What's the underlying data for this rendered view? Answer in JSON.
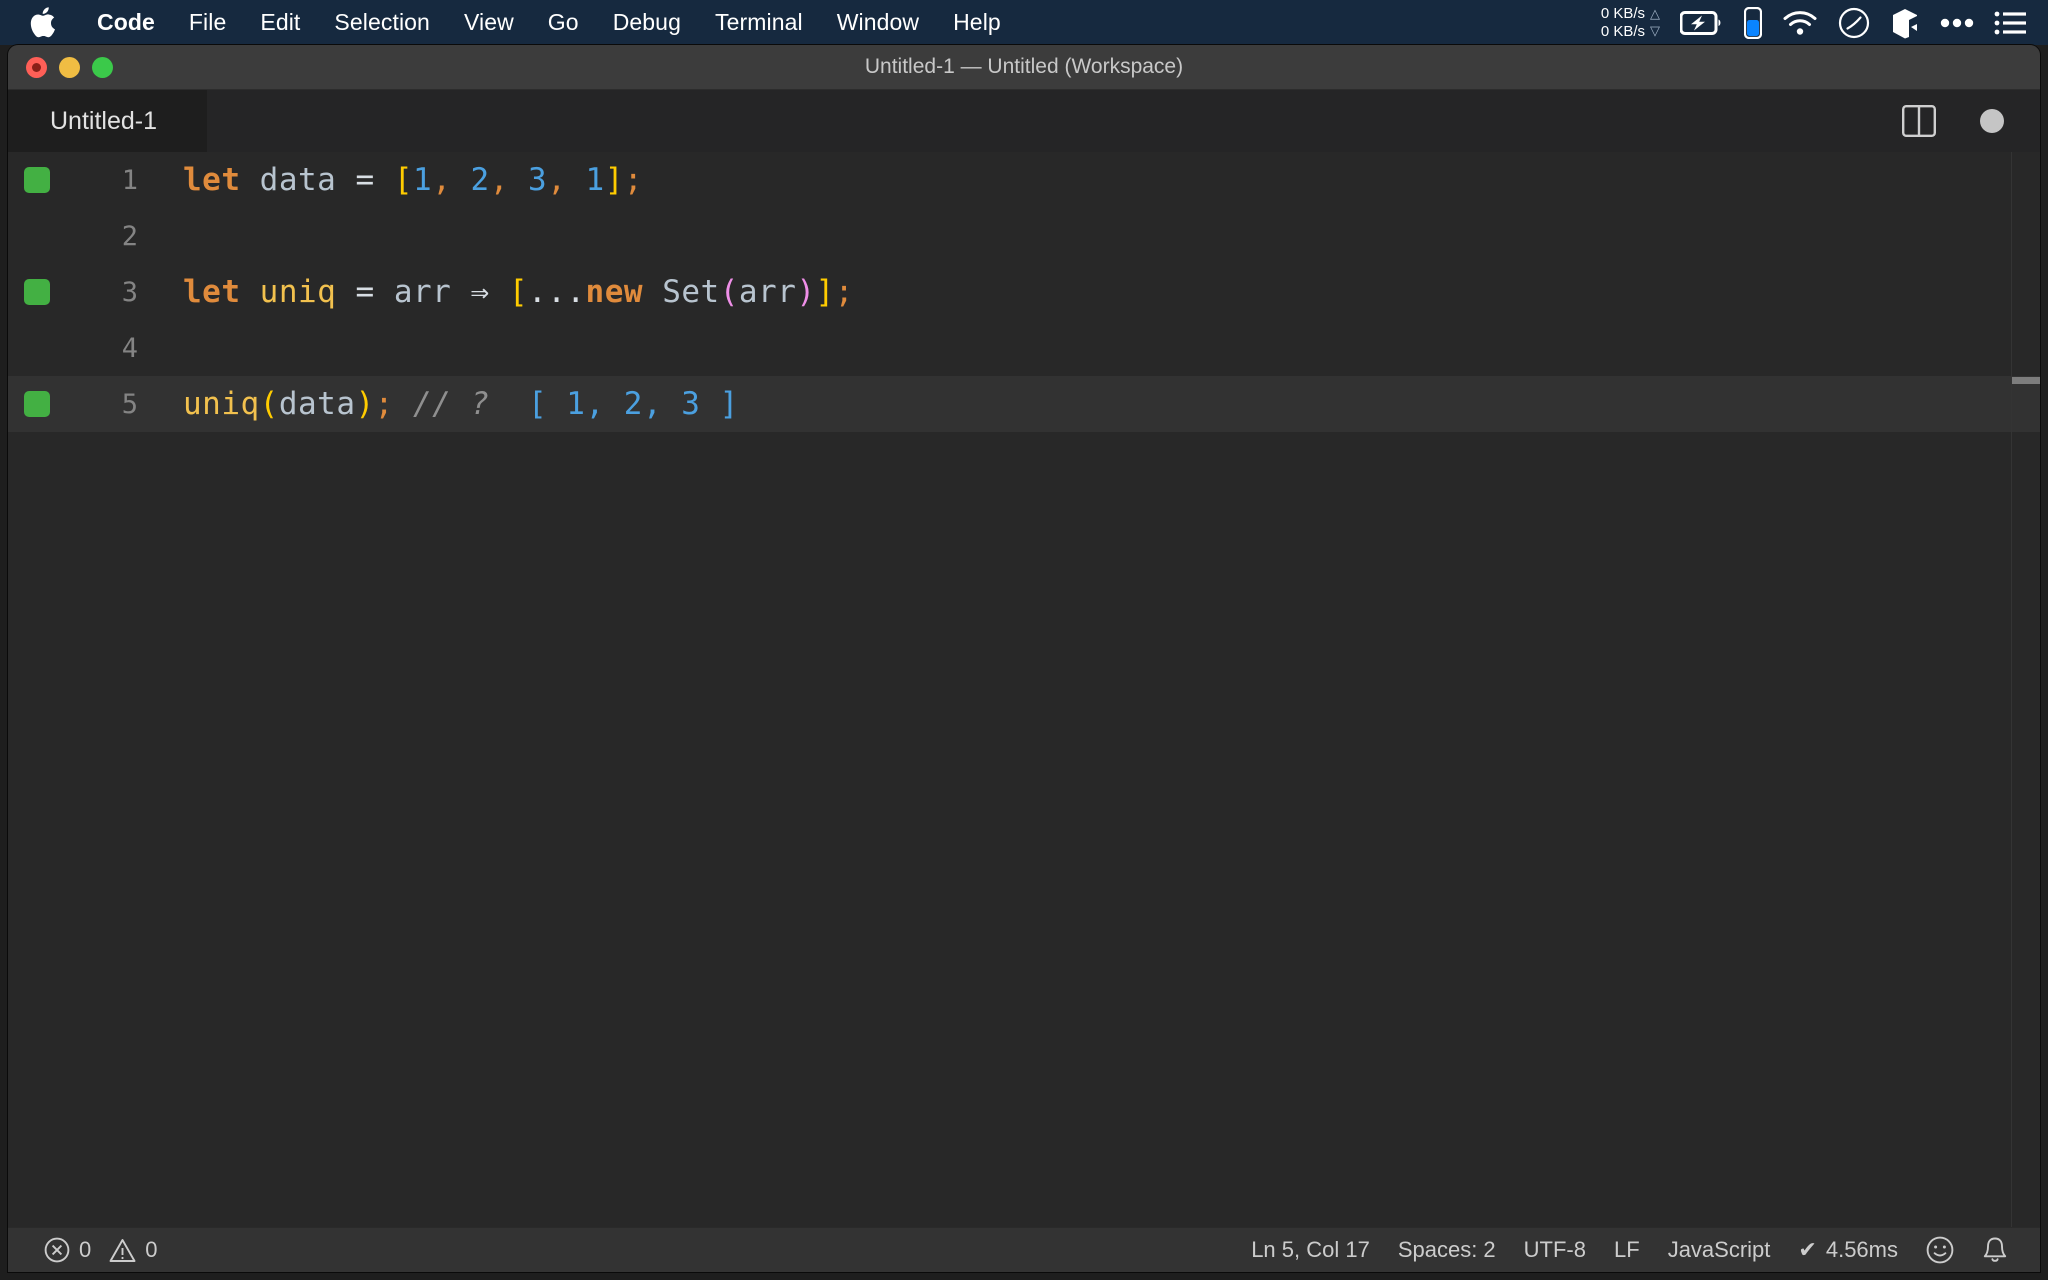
{
  "menubar": {
    "apple_icon": "apple-logo-icon",
    "items": [
      {
        "label": "Code",
        "bold": true
      },
      {
        "label": "File",
        "bold": false
      },
      {
        "label": "Edit",
        "bold": false
      },
      {
        "label": "Selection",
        "bold": false
      },
      {
        "label": "View",
        "bold": false
      },
      {
        "label": "Go",
        "bold": false
      },
      {
        "label": "Debug",
        "bold": false
      },
      {
        "label": "Terminal",
        "bold": false
      },
      {
        "label": "Window",
        "bold": false
      },
      {
        "label": "Help",
        "bold": false
      }
    ],
    "status": {
      "net_up": "0 KB/s",
      "net_down": "0 KB/s",
      "up_arrow": "△",
      "down_arrow": "▽",
      "icons": [
        "battery-charging-icon",
        "device-battery-icon",
        "wifi-icon",
        "do-not-disturb-icon",
        "cube-icon",
        "ellipsis-icon",
        "list-menu-icon"
      ]
    }
  },
  "window": {
    "title": "Untitled-1 — Untitled (Workspace)",
    "traffic_lights": [
      "close-button",
      "minimize-button",
      "maximize-button"
    ]
  },
  "tabbar": {
    "tab_label": "Untitled-1",
    "split_editor_icon": "split-editor-icon",
    "unsaved_indicator": "unsaved-dot-icon"
  },
  "editor": {
    "language_mode": "JavaScript",
    "lines": [
      {
        "number": "1",
        "marker": true,
        "tokens": [
          {
            "text": "let",
            "cls": "t-kw"
          },
          {
            "text": " ",
            "cls": "t-op"
          },
          {
            "text": "data",
            "cls": "t-var"
          },
          {
            "text": " ",
            "cls": "t-op"
          },
          {
            "text": "=",
            "cls": "t-op"
          },
          {
            "text": " ",
            "cls": "t-op"
          },
          {
            "text": "[",
            "cls": "t-brkt-y"
          },
          {
            "text": "1",
            "cls": "t-num"
          },
          {
            "text": ", ",
            "cls": "t-punc"
          },
          {
            "text": "2",
            "cls": "t-num"
          },
          {
            "text": ", ",
            "cls": "t-punc"
          },
          {
            "text": "3",
            "cls": "t-num"
          },
          {
            "text": ", ",
            "cls": "t-punc"
          },
          {
            "text": "1",
            "cls": "t-num"
          },
          {
            "text": "]",
            "cls": "t-brkt-y"
          },
          {
            "text": ";",
            "cls": "t-punc"
          }
        ]
      },
      {
        "number": "2",
        "marker": false,
        "tokens": []
      },
      {
        "number": "3",
        "marker": true,
        "tokens": [
          {
            "text": "let",
            "cls": "t-kw"
          },
          {
            "text": " ",
            "cls": "t-op"
          },
          {
            "text": "uniq",
            "cls": "t-func"
          },
          {
            "text": " ",
            "cls": "t-op"
          },
          {
            "text": "=",
            "cls": "t-op"
          },
          {
            "text": " ",
            "cls": "t-op"
          },
          {
            "text": "arr",
            "cls": "t-var"
          },
          {
            "text": " ",
            "cls": "t-op"
          },
          {
            "text": "⇒",
            "cls": "t-op"
          },
          {
            "text": " ",
            "cls": "t-op"
          },
          {
            "text": "[",
            "cls": "t-brkt-y"
          },
          {
            "text": "...",
            "cls": "t-op"
          },
          {
            "text": "new",
            "cls": "t-kw"
          },
          {
            "text": " ",
            "cls": "t-op"
          },
          {
            "text": "Set",
            "cls": "t-var"
          },
          {
            "text": "(",
            "cls": "t-brkt-m"
          },
          {
            "text": "arr",
            "cls": "t-var"
          },
          {
            "text": ")",
            "cls": "t-brkt-m"
          },
          {
            "text": "]",
            "cls": "t-brkt-y"
          },
          {
            "text": ";",
            "cls": "t-punc"
          }
        ]
      },
      {
        "number": "4",
        "marker": false,
        "tokens": []
      },
      {
        "number": "5",
        "marker": true,
        "active": true,
        "tokens": [
          {
            "text": "uniq",
            "cls": "t-func"
          },
          {
            "text": "(",
            "cls": "t-brkt-y"
          },
          {
            "text": "data",
            "cls": "t-var"
          },
          {
            "text": ")",
            "cls": "t-brkt-y"
          },
          {
            "text": ";",
            "cls": "t-punc"
          },
          {
            "text": " ",
            "cls": "t-op"
          },
          {
            "text": "// ?",
            "cls": "t-comment"
          },
          {
            "text": "  ",
            "cls": "t-op"
          },
          {
            "text": "[ 1, 2, 3 ]",
            "cls": "t-result"
          }
        ]
      }
    ]
  },
  "statusbar": {
    "errors_icon": "error-circle-icon",
    "errors_count": "0",
    "warnings_icon": "warning-triangle-icon",
    "warnings_count": "0",
    "cursor_position": "Ln 5, Col 17",
    "indentation": "Spaces: 2",
    "encoding": "UTF-8",
    "eol": "LF",
    "language": "JavaScript",
    "run_check": "✔",
    "run_time": "4.56ms",
    "feedback_icon": "smiley-icon",
    "notifications_icon": "bell-icon"
  },
  "colors": {
    "menubar_bg": "#16293f",
    "titlebar_bg": "#3c3c3c",
    "tabbar_bg": "#252526",
    "editor_bg": "#282828",
    "statusbar_bg": "#333333",
    "quokka_green": "#43b043",
    "keyword_orange": "#e08b3c",
    "number_blue": "#4ba0e0",
    "bracket_yellow": "#ffcc00",
    "bracket_magenta": "#ef8fe8"
  }
}
